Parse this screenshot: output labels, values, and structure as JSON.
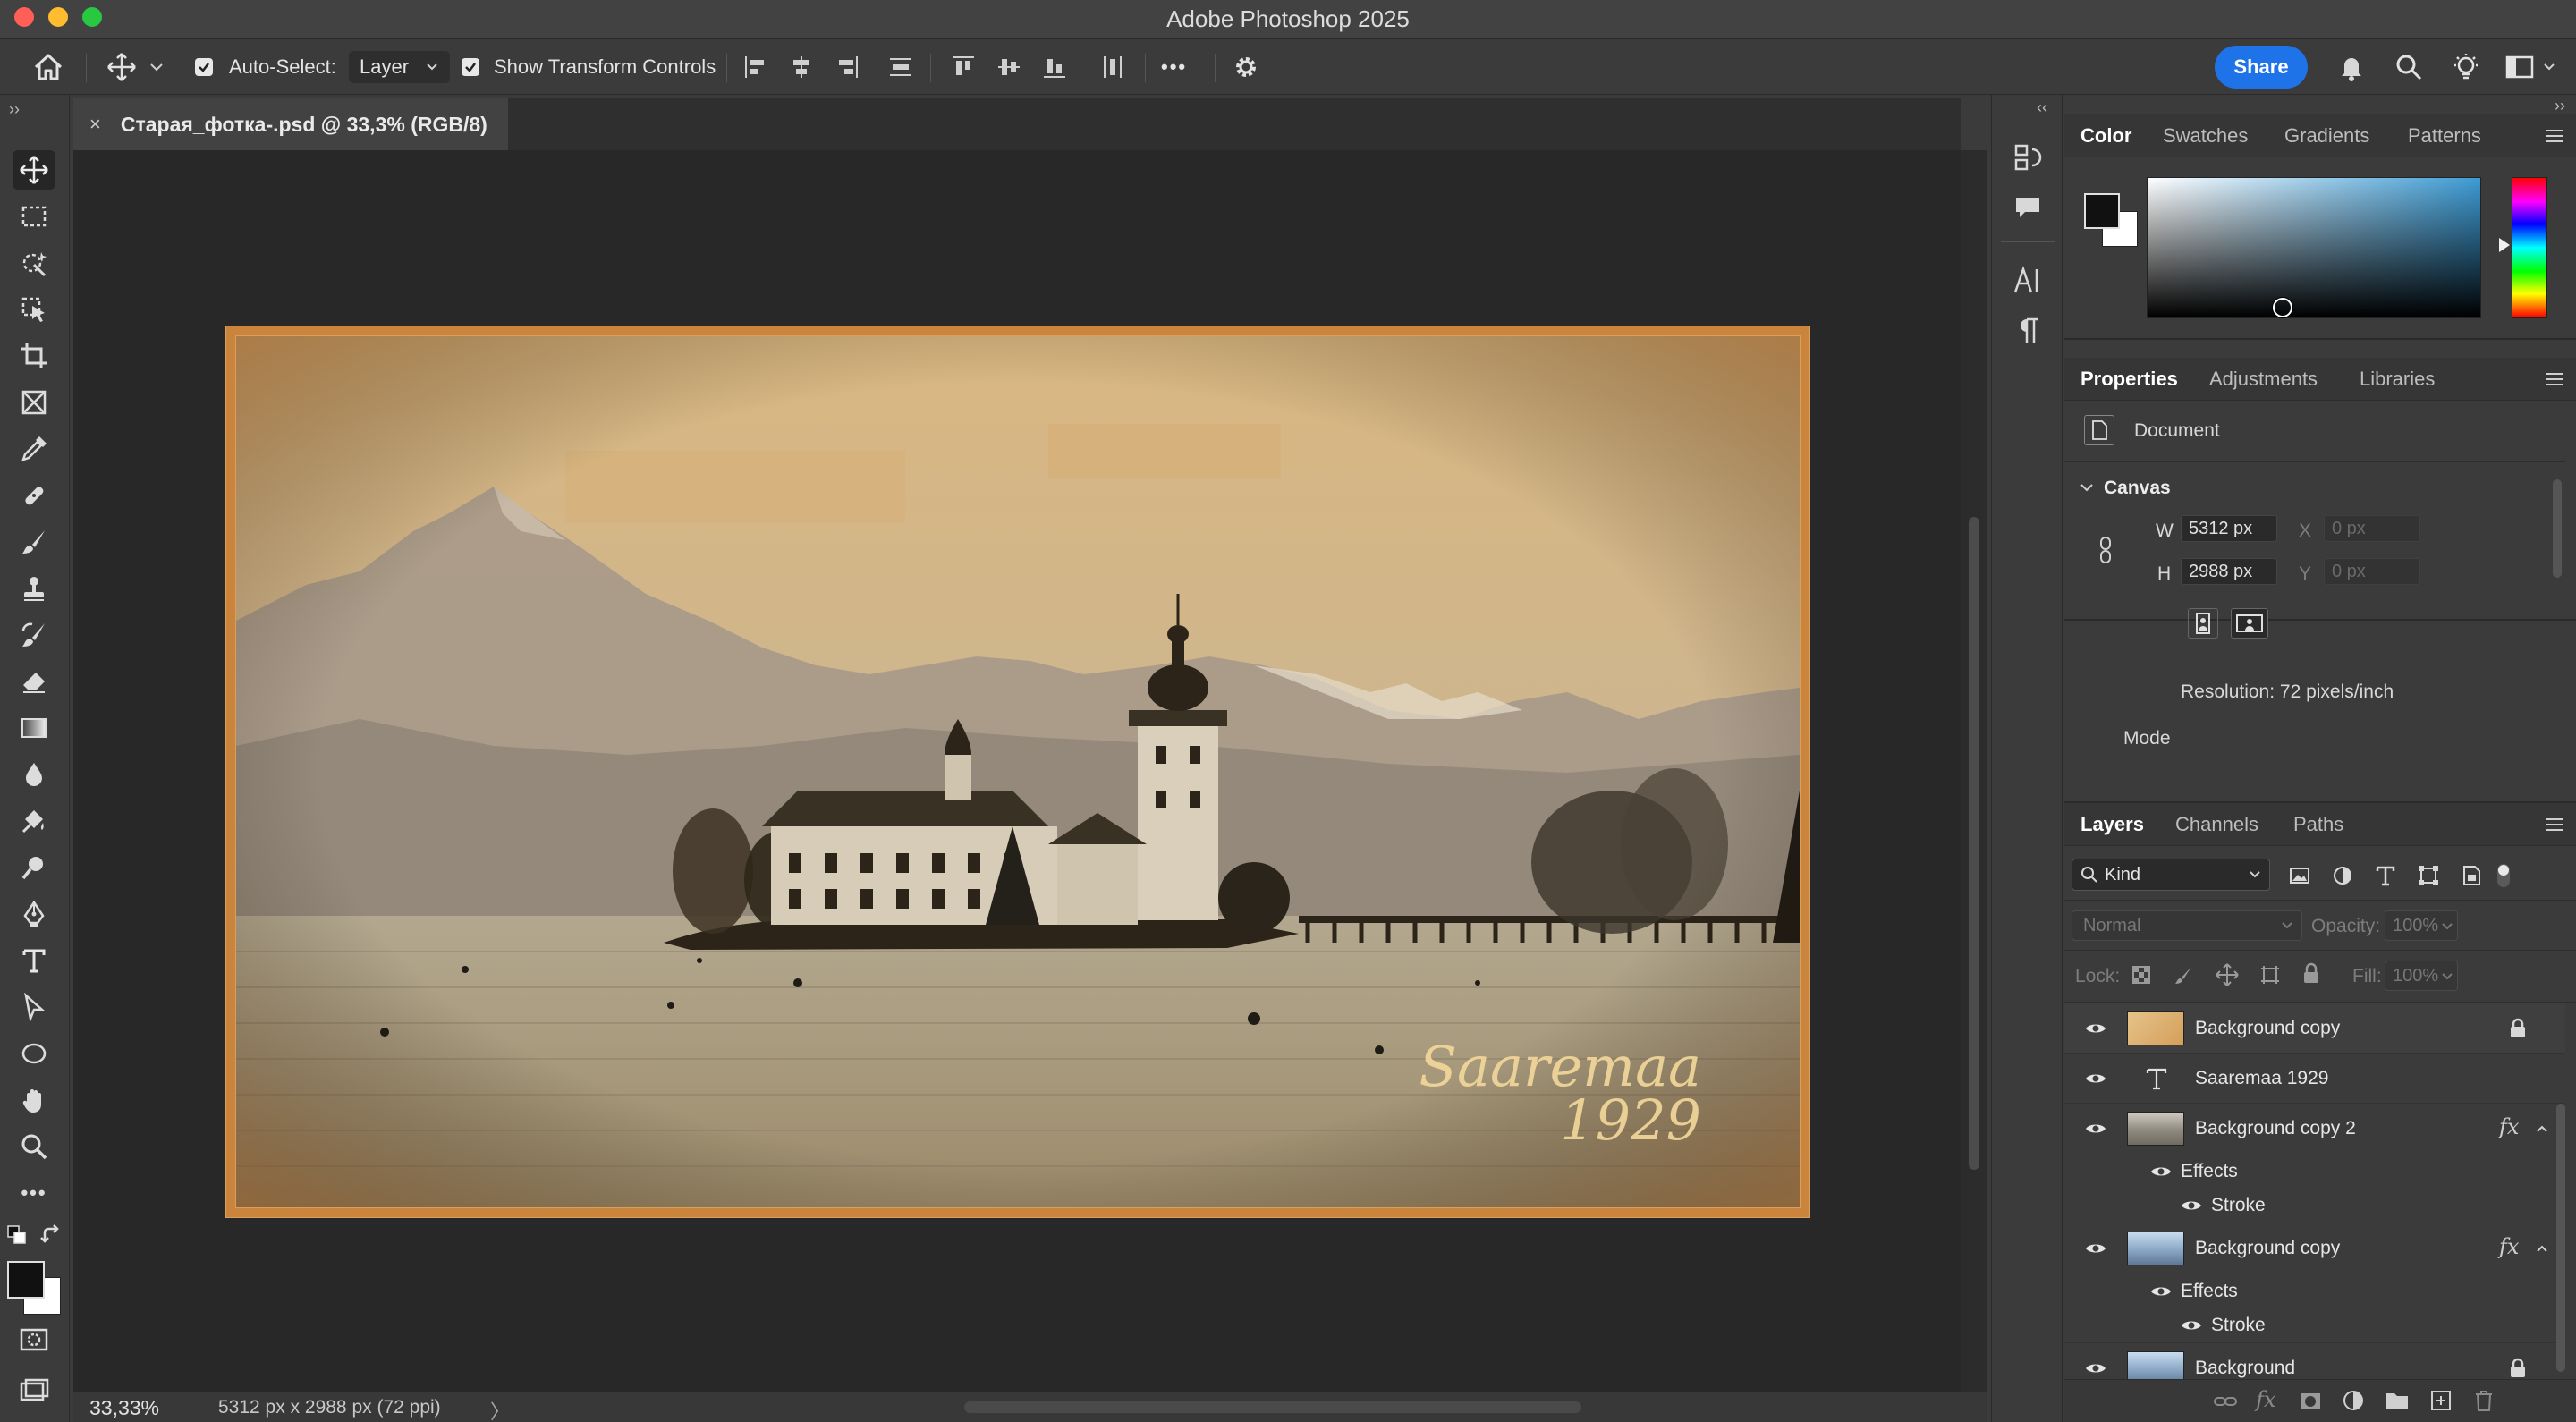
{
  "window": {
    "title": "Adobe Photoshop 2025"
  },
  "options_bar": {
    "auto_select_label": "Auto-Select:",
    "auto_select_value": "Layer",
    "show_transform_label": "Show Transform Controls",
    "more_label": "•••",
    "share_label": "Share"
  },
  "document": {
    "tab_title": "Старая_фотка-.psd @ 33,3% (RGB/8)",
    "close_glyph": "×",
    "photo_text_line1": "Saaremaa",
    "photo_text_line2": "1929"
  },
  "status": {
    "zoom": "33,33%",
    "dimensions": "5312 px x 2988 px (72 ppi)",
    "arrow": "〉"
  },
  "color_panel": {
    "tabs": [
      "Color",
      "Swatches",
      "Gradients",
      "Patterns"
    ],
    "active_tab": "Color",
    "foreground": "#111111",
    "background": "#ffffff"
  },
  "properties_panel": {
    "tabs": [
      "Properties",
      "Adjustments",
      "Libraries"
    ],
    "active_tab": "Properties",
    "document_label": "Document",
    "canvas_label": "Canvas",
    "w_label": "W",
    "w_value": "5312 px",
    "h_label": "H",
    "h_value": "2988 px",
    "x_label": "X",
    "x_placeholder": "0 px",
    "y_label": "Y",
    "y_placeholder": "0 px",
    "resolution": "Resolution: 72 pixels/inch",
    "mode_label": "Mode"
  },
  "layers_panel": {
    "tabs": [
      "Layers",
      "Channels",
      "Paths"
    ],
    "active_tab": "Layers",
    "filter_kind": "Kind",
    "blend_mode": "Normal",
    "opacity_label": "Opacity:",
    "opacity_value": "100%",
    "lock_label": "Lock:",
    "fill_label": "Fill:",
    "fill_value": "100%",
    "layers": [
      {
        "name": "Background copy",
        "type": "image",
        "locked": true
      },
      {
        "name": "Saaremaa  1929",
        "type": "text"
      },
      {
        "name": "Background copy 2",
        "type": "image",
        "fx": "fx",
        "effects_label": "Effects",
        "effect": "Stroke"
      },
      {
        "name": "Background copy",
        "type": "image",
        "fx": "fx",
        "effects_label": "Effects",
        "effect": "Stroke"
      },
      {
        "name": "Background",
        "type": "image",
        "locked": true
      }
    ]
  },
  "colors": {
    "accent": "#1f73e8",
    "app_bg": "#3b3b3b",
    "canvas_bg": "#282828"
  }
}
